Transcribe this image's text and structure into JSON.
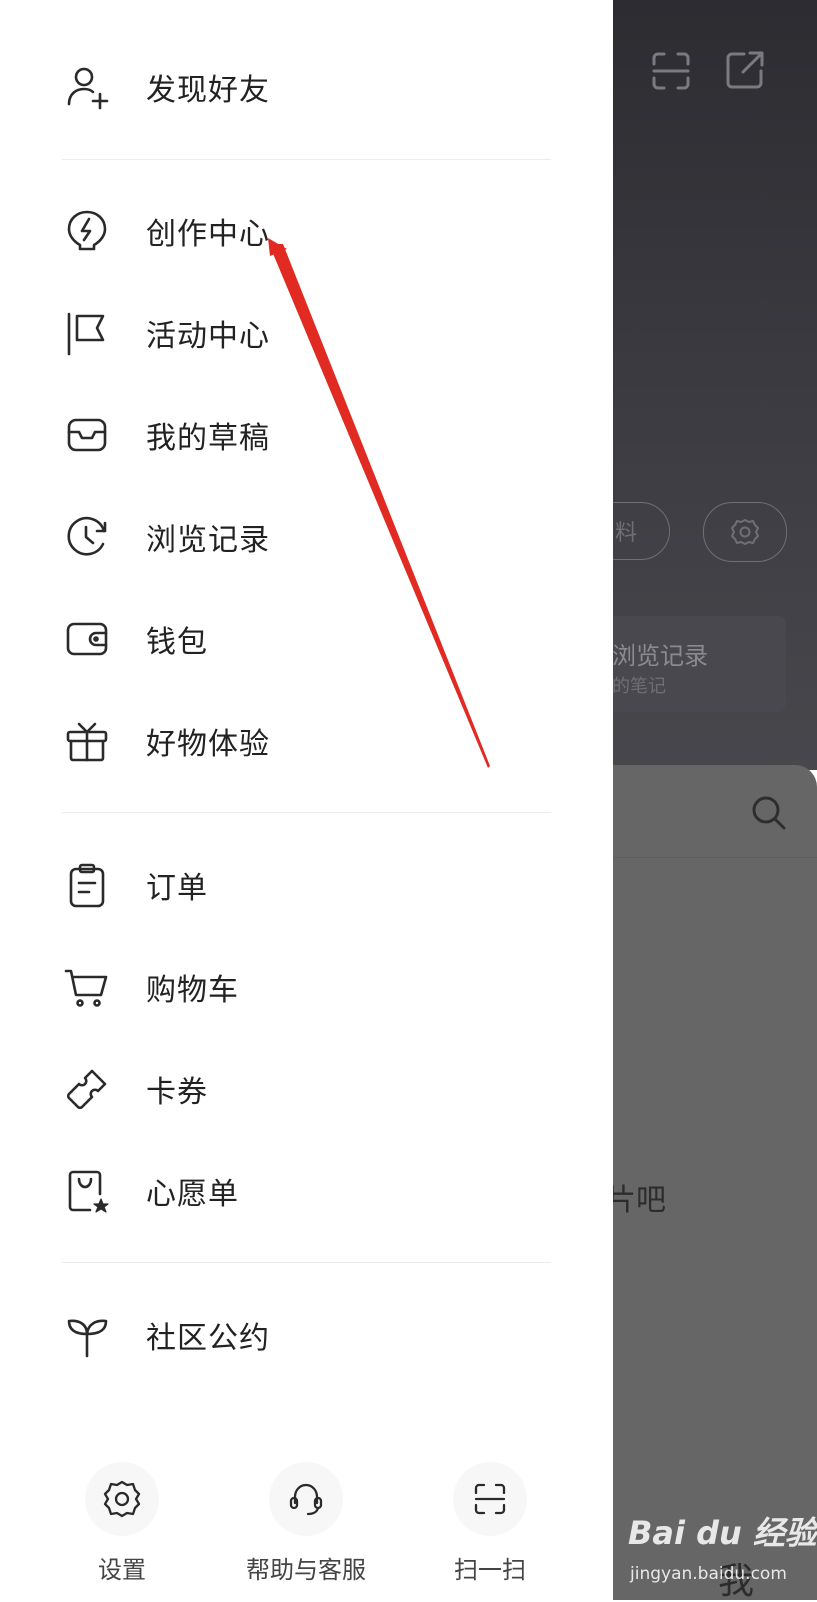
{
  "drawer": {
    "section1": [
      {
        "label": "发现好友",
        "icon": "add-friend-icon"
      }
    ],
    "section2": [
      {
        "label": "创作中心",
        "icon": "lightbulb-bolt-icon"
      },
      {
        "label": "活动中心",
        "icon": "flag-icon"
      },
      {
        "label": "我的草稿",
        "icon": "inbox-icon"
      },
      {
        "label": "浏览记录",
        "icon": "history-clock-icon"
      },
      {
        "label": "钱包",
        "icon": "wallet-icon"
      },
      {
        "label": "好物体验",
        "icon": "gift-icon"
      }
    ],
    "section3": [
      {
        "label": "订单",
        "icon": "clipboard-icon"
      },
      {
        "label": "购物车",
        "icon": "cart-icon"
      },
      {
        "label": "卡券",
        "icon": "coupon-icon"
      },
      {
        "label": "心愿单",
        "icon": "wishlist-bag-icon"
      }
    ],
    "section4": [
      {
        "label": "社区公约",
        "icon": "sprout-icon"
      }
    ],
    "bottom": [
      {
        "label": "设置",
        "icon": "gear-icon"
      },
      {
        "label": "帮助与客服",
        "icon": "headset-icon"
      },
      {
        "label": "扫一扫",
        "icon": "scan-icon"
      }
    ]
  },
  "background": {
    "pill_text": "料",
    "card_title": "浏览记录",
    "card_subtitle": "的笔记",
    "mid_text": "片吧",
    "bottom_text": "我"
  },
  "watermark": {
    "brand": "Bai du 经验",
    "url": "jingyan.baidu.com"
  },
  "colors": {
    "annotation_arrow": "#e02a22",
    "drawer_bg": "#ffffff",
    "overlay_bg": "#666666"
  }
}
